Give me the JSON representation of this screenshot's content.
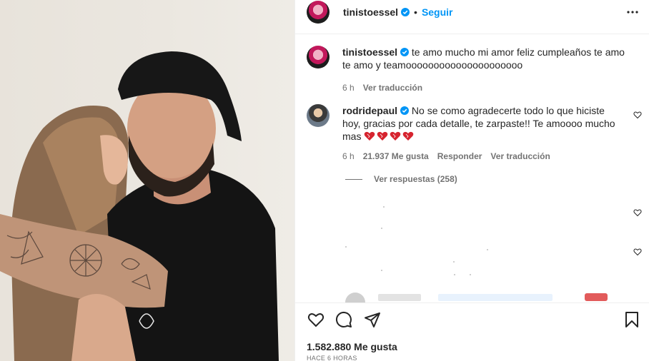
{
  "post": {
    "username": "tinistoessel",
    "follow_label": "Seguir",
    "separator": "•"
  },
  "caption": {
    "username": "tinistoessel",
    "text_line1": "te amo mucho mi amor feliz cumpleaños te amo",
    "text_line2": "te amo y teamooooooooooooooooooooo",
    "time": "6 h",
    "translate": "Ver traducción"
  },
  "comment1": {
    "username": "rodridepaul",
    "text_line1": "No se como agradecerte todo lo que hiciste",
    "text_line2": "hoy, gracias por cada detalle, te zarpaste!! Te amoooo mucho",
    "text_line3": "mas",
    "time": "6 h",
    "likes": "21.937 Me gusta",
    "reply": "Responder",
    "translate": "Ver traducción"
  },
  "replies": {
    "label": "Ver respuestas (258)"
  },
  "footer": {
    "likes": "1.582.880 Me gusta",
    "time_ago": "HACE 6 HORAS"
  },
  "colors": {
    "accent": "#0095f6",
    "text": "#262626",
    "muted": "#737373",
    "heart": "#ed4956"
  },
  "icons": [
    "more-options-icon",
    "verified-icon",
    "heart-icon",
    "comment-icon",
    "share-icon",
    "save-icon"
  ]
}
